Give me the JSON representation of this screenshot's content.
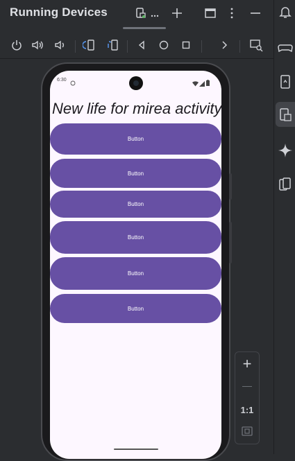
{
  "window": {
    "title": "Running Devices",
    "icons": [
      "device-tab-icon",
      "more-icon",
      "add-icon",
      "window-icon",
      "kebab-icon",
      "minimize-icon"
    ]
  },
  "toolbar": {
    "buttons": [
      "power-icon",
      "volume-up-icon",
      "volume-down-icon",
      "rotate-left-icon",
      "rotate-right-icon",
      "back-icon",
      "home-icon",
      "overview-icon",
      "more-chevron-icon",
      "screenshot-icon"
    ]
  },
  "right_sidebar": {
    "icons": [
      "notifications-icon",
      "gamepad-icon",
      "device-file-icon",
      "running-devices-icon",
      "gemini-icon",
      "device-mirror-icon"
    ],
    "active": "running-devices-icon"
  },
  "device": {
    "status_time": "6:30",
    "heading": "New life for mirea activity!",
    "buttons": [
      {
        "label": "Button"
      },
      {
        "label": "Button"
      },
      {
        "label": "Button"
      },
      {
        "label": "Button"
      },
      {
        "label": "Button"
      },
      {
        "label": "Button"
      }
    ],
    "colors": {
      "button": "#6750a4",
      "screen": "#fdf7ff"
    }
  },
  "zoom_panel": {
    "zoom_in": "+",
    "zoom_out": "—",
    "ratio": "1:1"
  }
}
